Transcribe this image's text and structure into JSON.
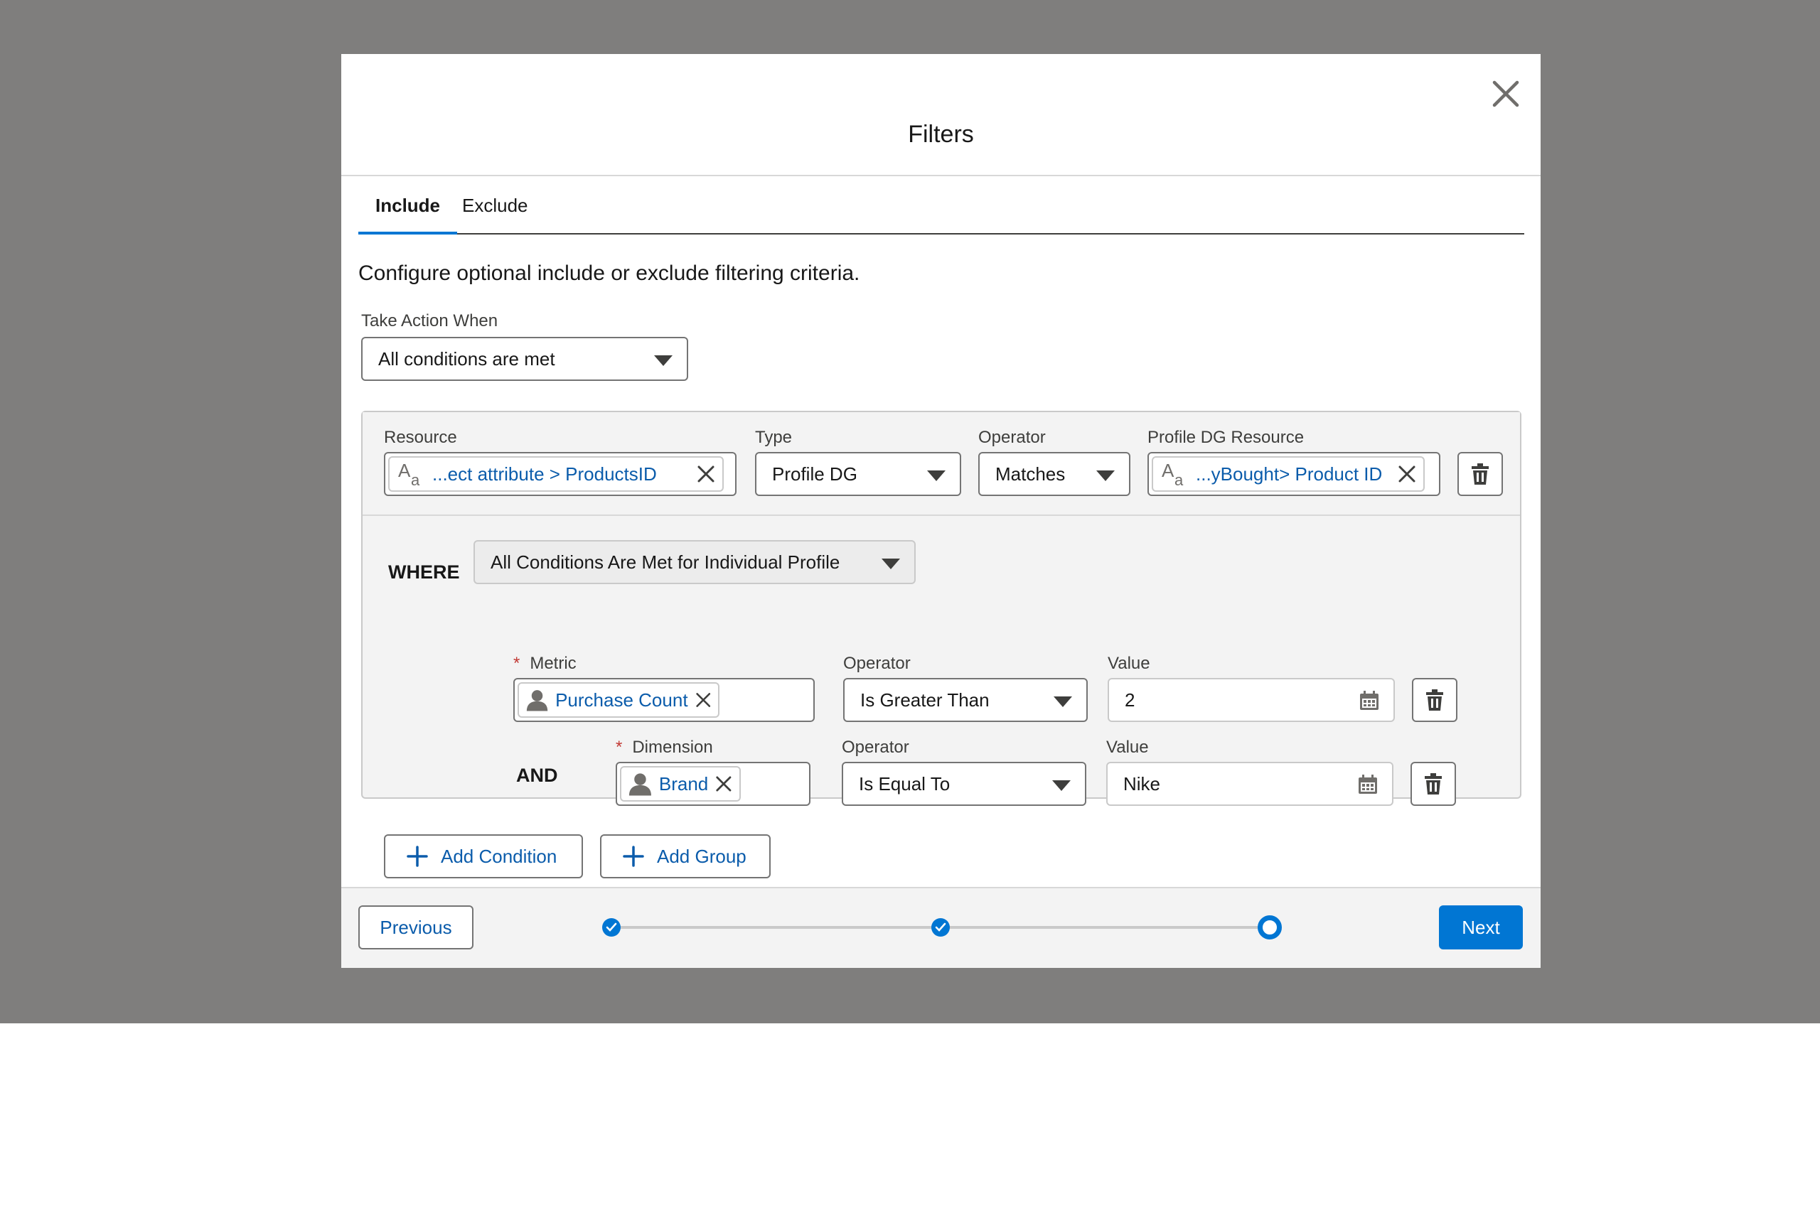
{
  "modal": {
    "title": "Filters"
  },
  "tabs": [
    {
      "label": "Include",
      "active": true
    },
    {
      "label": "Exclude",
      "active": false
    }
  ],
  "intro_text": "Configure optional include or exclude filtering criteria.",
  "take_action": {
    "label": "Take Action When",
    "value": "All conditions are met"
  },
  "resource_row": {
    "resource_label": "Resource",
    "resource_value": "...ect attribute > ProductsID",
    "type_label": "Type",
    "type_value": "Profile DG",
    "operator_label": "Operator",
    "operator_value": "Matches",
    "profile_dg_label": "Profile DG Resource",
    "profile_dg_value": "...yBought> Product ID"
  },
  "where": {
    "keyword": "WHERE",
    "value": "All Conditions Are Met for Individual Profile",
    "metric_row": {
      "required_mark": "*",
      "label": "Metric",
      "value": "Purchase Count",
      "operator_label": "Operator",
      "operator_value": "Is Greater Than",
      "value_label": "Value",
      "value_value": "2"
    },
    "dimension_row": {
      "connector": "AND",
      "required_mark": "*",
      "label": "Dimension",
      "value": "Brand",
      "operator_label": "Operator",
      "operator_value": "Is Equal To",
      "value_label": "Value",
      "value_value": "Nike"
    }
  },
  "actions": {
    "add_condition": "Add Condition",
    "add_group": "Add Group"
  },
  "footer": {
    "previous": "Previous",
    "next": "Next",
    "progress": {
      "steps_total": 3,
      "steps_completed": 2,
      "current_step": 3
    }
  },
  "colors": {
    "backdrop": "#7f7e7d",
    "brand": "#0176d3",
    "link": "#0b5cab"
  }
}
